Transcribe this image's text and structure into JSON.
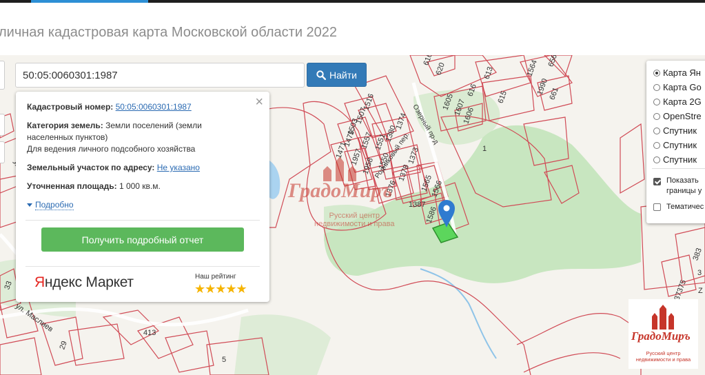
{
  "page": {
    "title": "личная кадастровая карта Московской области 2022"
  },
  "search": {
    "value": "50:05:0060301:1987",
    "button_label": "Найти"
  },
  "popup": {
    "cadastral_label": "Кадастровый номер:",
    "cadastral_value": "50:05:0060301:1987",
    "category_label": "Категория земель:",
    "category_value_line1": "Земли поселений (земли",
    "category_value_line2": "населенных пунктов)",
    "usage": "Для ведения личного подсобного хозяйства",
    "address_label": "Земельный участок по адресу:",
    "address_value": "Не указано",
    "area_label": "Уточненная площадь:",
    "area_value": "1 000 кв.м.",
    "more_label": "Подробно",
    "report_button": "Получить подробный отчет",
    "partner_brand_y": "Я",
    "partner_brand_rest": "ндекс",
    "partner_brand_2": "Маркет",
    "rating_label": "Наш рейтинг",
    "stars": "★★★★★",
    "close": "×"
  },
  "layers": {
    "items": [
      {
        "label": "Карта Ян",
        "selected": true
      },
      {
        "label": "Карта Go",
        "selected": false
      },
      {
        "label": "Карта 2G",
        "selected": false
      },
      {
        "label": "OpenStre",
        "selected": false
      },
      {
        "label": "Спутник",
        "selected": false
      },
      {
        "label": "Спутник",
        "selected": false
      },
      {
        "label": "Спутник",
        "selected": false
      }
    ],
    "show_borders_line1": "Показать",
    "show_borders_line2": "границы у",
    "show_borders_checked": true,
    "thematic": "Тематичес",
    "thematic_checked": false
  },
  "map": {
    "street_1": "ул. Маслиев",
    "street_2": "ул. Маслие",
    "lane_1": "Родниковый пер.",
    "lane_2": "Озерный пр-д",
    "parcel_numbers": [
      "616",
      "620",
      "613",
      "1564",
      "656",
      "1990",
      "661",
      "1605",
      "616",
      "615",
      "1607",
      "1606",
      "1516",
      "1507",
      "1503",
      "1374",
      "1380",
      "1479",
      "1557",
      "1551",
      "1373",
      "1471",
      "1957",
      "1958",
      "1550",
      "1378",
      "1376",
      "1565",
      "1566",
      "1387",
      "1586",
      "1",
      "413",
      "5",
      "29",
      "33",
      "383",
      "3",
      "37375",
      "Z"
    ]
  },
  "watermark": {
    "name": "ГрадоМиръ",
    "sub_line1": "Русский центр",
    "sub_line2": "недвижимости и права"
  },
  "colors": {
    "accent": "#2d8fd5",
    "search_button": "#337ab7",
    "report_button": "#5cb85c",
    "parcel_border": "#d04a55",
    "green_area": "#c3e4bb",
    "selected_parcel": "#5cd65c",
    "marker": "#2f7bd0",
    "stars": "#f6b400",
    "watermark": "#c6352a"
  }
}
